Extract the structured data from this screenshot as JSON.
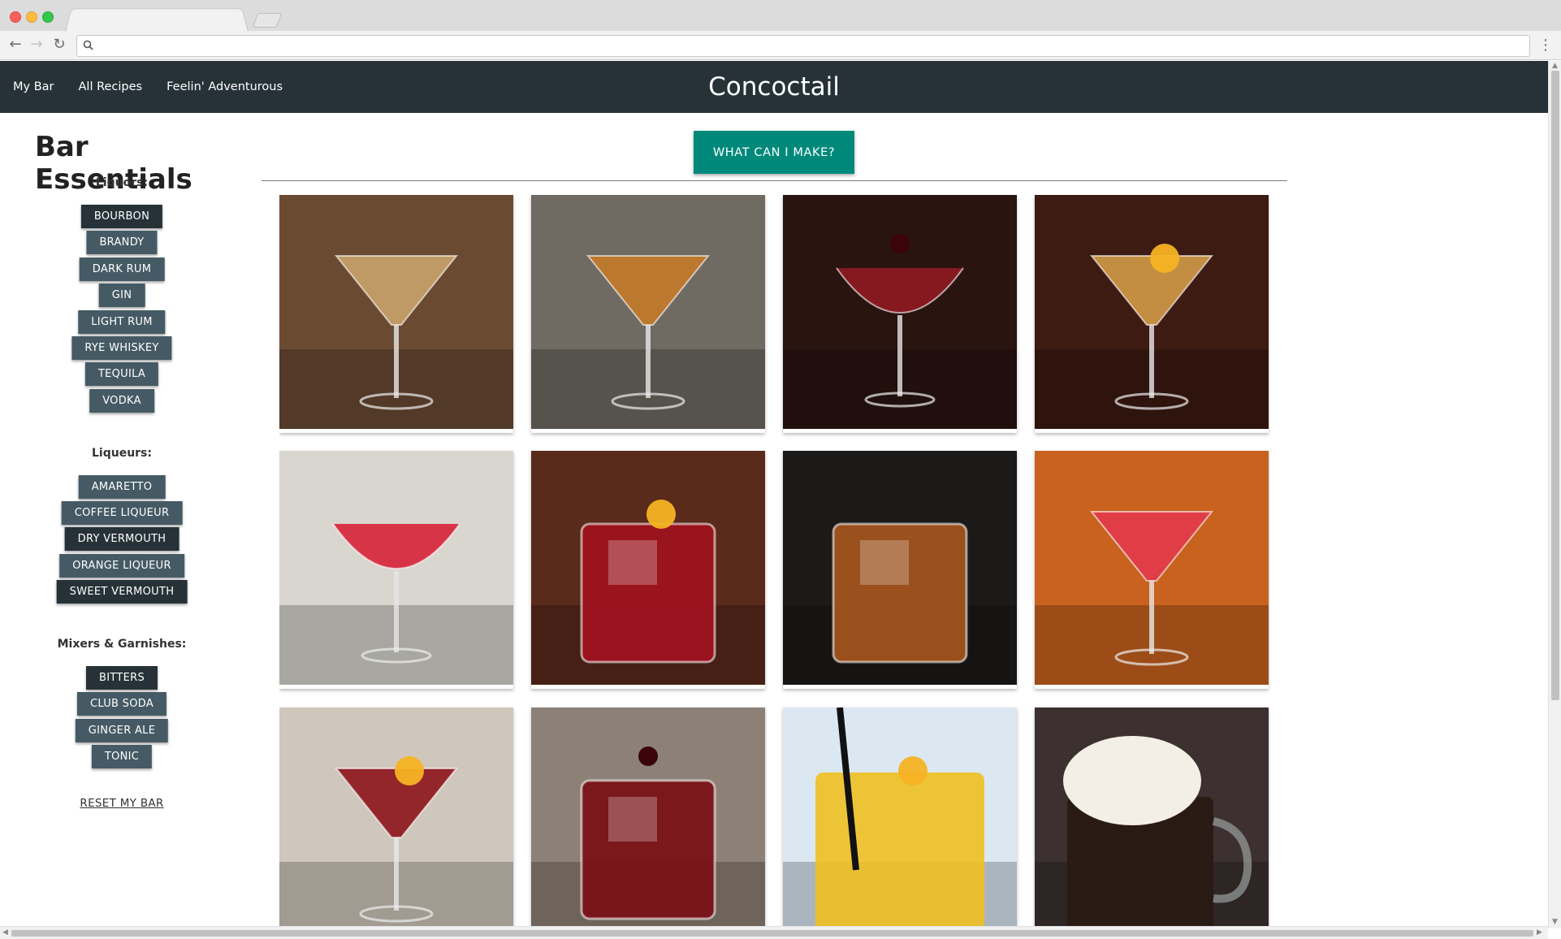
{
  "app": {
    "brand": "Concoctail",
    "nav": [
      "My Bar",
      "All Recipes",
      "Feelin' Adventurous"
    ]
  },
  "sidebar": {
    "title": "Bar Essentials",
    "sections": [
      {
        "label": "Liquors:",
        "items": [
          {
            "label": "BOURBON",
            "selected": true
          },
          {
            "label": "BRANDY",
            "selected": false
          },
          {
            "label": "DARK RUM",
            "selected": false
          },
          {
            "label": "GIN",
            "selected": false
          },
          {
            "label": "LIGHT RUM",
            "selected": false
          },
          {
            "label": "RYE WHISKEY",
            "selected": false
          },
          {
            "label": "TEQUILA",
            "selected": false
          },
          {
            "label": "VODKA",
            "selected": false
          }
        ]
      },
      {
        "label": "Liqueurs:",
        "items": [
          {
            "label": "AMARETTO",
            "selected": false
          },
          {
            "label": "COFFEE LIQUEUR",
            "selected": false
          },
          {
            "label": "DRY VERMOUTH",
            "selected": true
          },
          {
            "label": "ORANGE LIQUEUR",
            "selected": false
          },
          {
            "label": "SWEET VERMOUTH",
            "selected": true
          }
        ]
      },
      {
        "label": "Mixers & Garnishes:",
        "items": [
          {
            "label": "BITTERS",
            "selected": true
          },
          {
            "label": "CLUB SODA",
            "selected": false
          },
          {
            "label": "GINGER ALE",
            "selected": false
          },
          {
            "label": "TONIC",
            "selected": false
          }
        ]
      }
    ],
    "reset_label": "RESET MY BAR"
  },
  "main": {
    "make_button_label": "WHAT CAN I MAKE?",
    "cards": [
      {
        "photo": "martini-glass-cafe",
        "colors": {
          "bg": "#6b4a32",
          "liquid": "#c9a36a"
        }
      },
      {
        "photo": "martini-glass-stone-wall",
        "colors": {
          "bg": "#6f6a62",
          "liquid": "#c47a2a"
        }
      },
      {
        "photo": "coupe-cherry-dark",
        "colors": {
          "bg": "#2a1410",
          "liquid": "#8e1a22"
        }
      },
      {
        "photo": "martini-glass-lemon",
        "colors": {
          "bg": "#3d1a12",
          "liquid": "#d29a48"
        }
      },
      {
        "photo": "coupe-red-hand",
        "colors": {
          "bg": "#d9d6cf",
          "liquid": "#d8263c"
        }
      },
      {
        "photo": "rocks-red-orange",
        "colors": {
          "bg": "#5a2a1a",
          "liquid": "#a0121e"
        }
      },
      {
        "photo": "old-fashioned-ice",
        "colors": {
          "bg": "#1c1a18",
          "liquid": "#a5561e"
        }
      },
      {
        "photo": "two-martinis-bottles",
        "colors": {
          "bg": "#c8621e",
          "liquid": "#e23a4a"
        }
      },
      {
        "photo": "martini-red-twist",
        "colors": {
          "bg": "#cfc7bb",
          "liquid": "#8c141c"
        }
      },
      {
        "photo": "rocks-red-olive",
        "colors": {
          "bg": "#8d8177",
          "liquid": "#7a0f14"
        }
      },
      {
        "photo": "highball-lemon-straw",
        "colors": {
          "bg": "#dbe8f2",
          "liquid": "#f0c022"
        }
      },
      {
        "photo": "float-ice-cream-mug",
        "colors": {
          "bg": "#3c3030",
          "liquid": "#2a1a14"
        }
      }
    ]
  }
}
